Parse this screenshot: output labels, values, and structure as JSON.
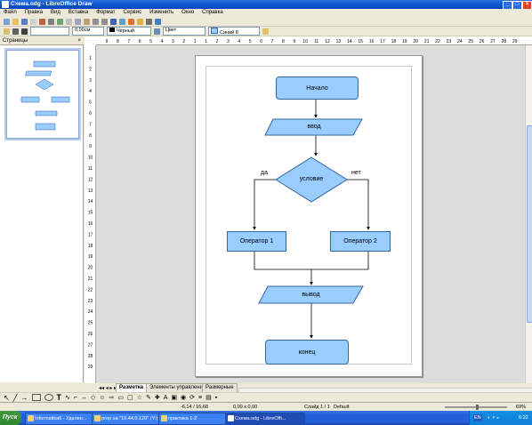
{
  "window": {
    "title": "Схема.odg - LibreOffice Draw",
    "min": "_",
    "max": "□",
    "close": "×"
  },
  "menu": [
    "Файл",
    "Правка",
    "Вид",
    "Вставка",
    "Формат",
    "Сервис",
    "Изменить",
    "Окно",
    "Справка"
  ],
  "line_toolbar": {
    "line_width": "0,00см",
    "color": "Чёрный",
    "area_style": "Цвет",
    "area_color": "Синий 8"
  },
  "side_panel": {
    "title": "Страницы",
    "page_number": "1"
  },
  "ruler": {
    "h_ticks": [
      "9",
      "8",
      "7",
      "6",
      "5",
      "4",
      "3",
      "2",
      "1",
      "1",
      "2",
      "3",
      "4",
      "5",
      "6",
      "7",
      "8",
      "9",
      "10",
      "11",
      "12",
      "13",
      "14",
      "15",
      "16",
      "17",
      "18",
      "19",
      "20",
      "21",
      "22",
      "23",
      "24",
      "25",
      "26",
      "27",
      "28",
      "29"
    ],
    "v_ticks": [
      "1",
      "2",
      "3",
      "4",
      "5",
      "6",
      "7",
      "8",
      "9",
      "10",
      "11",
      "12",
      "13",
      "14",
      "15",
      "16",
      "17",
      "18",
      "19",
      "20",
      "21",
      "22",
      "23",
      "24",
      "25",
      "26",
      "27",
      "28",
      "29"
    ]
  },
  "flowchart": {
    "start": "Начало",
    "input": "ввод",
    "condition": "условие",
    "yes": "да",
    "no": "нет",
    "op1": "Оператор 1",
    "op2": "Оператор 2",
    "output": "вывод",
    "end": "конец"
  },
  "tabs": [
    "Разметка",
    "Элементы управления",
    "Размерные"
  ],
  "status": {
    "position": "-6,14 / 16,68",
    "size": "0,00 x 0,00",
    "slide": "Слайд 1 / 1",
    "layout": "Default",
    "zoom": "69%"
  },
  "taskbar": {
    "start": "Пуск",
    "tasks": [
      "Informatika6 - Удален...",
      "prep на \"10.44.0.120\" (Y:)",
      "практика 1-2",
      "Схема.odg - LibreOffi..."
    ],
    "lang": "EN",
    "time": "6:22"
  }
}
